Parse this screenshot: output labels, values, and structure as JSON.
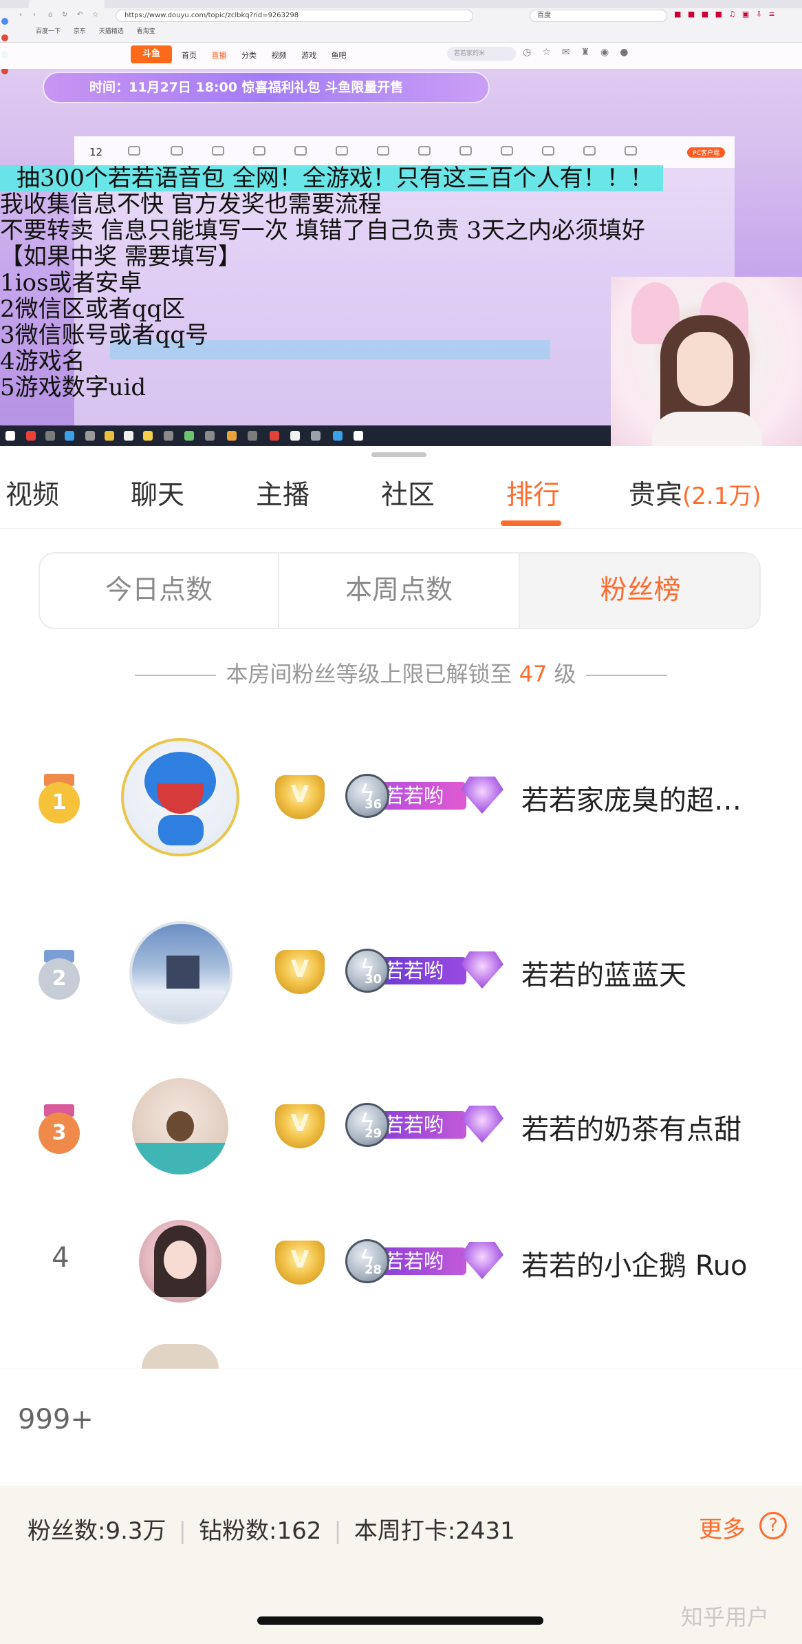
{
  "browser": {
    "url": "https://www.douyu.com/topic/zclbkq?rid=9263298",
    "search_engine": "百度",
    "bookmarks": [
      "百度一下",
      "京东",
      "天猫精选",
      "看淘宝"
    ]
  },
  "site_nav": {
    "logo": "斗鱼",
    "links": [
      "首页",
      "直播",
      "分类",
      "视频",
      "游戏",
      "鱼吧"
    ],
    "search_placeholder": "若若家的米"
  },
  "stream": {
    "banner": "时间：11月27日 18:00  惊喜福利礼包  斗鱼限量开售",
    "toolbar_count": "12",
    "pc_button": "PC客户端",
    "overlay_lines": [
      "抽300个若若语音包 全网！全游戏！只有这三百个人有！！！",
      "我收集信息不快 官方发奖也需要流程",
      "不要转卖 信息只能填写一次 填错了自己负责 3天之内必须填好",
      "【如果中奖 需要填写】",
      "1ios或者安卓",
      "2微信区或者qq区",
      "3微信账号或者qq号",
      "4游戏名",
      "5游戏数字uid"
    ]
  },
  "tabs": [
    {
      "label": "视频"
    },
    {
      "label": "聊天"
    },
    {
      "label": "主播"
    },
    {
      "label": "社区"
    },
    {
      "label": "排行",
      "active": true
    },
    {
      "label": "贵宾",
      "count": "(2.1万)"
    }
  ],
  "segments": [
    {
      "label": "今日点数"
    },
    {
      "label": "本周点数"
    },
    {
      "label": "粉丝榜",
      "active": true
    }
  ],
  "notice": {
    "prefix": "本房间粉丝等级上限已解锁至",
    "level": "47",
    "suffix": "级"
  },
  "ranking": [
    {
      "rank": "1",
      "badge_level": "36",
      "badge_text": "若若哟",
      "name": "若若家庞臭的超…"
    },
    {
      "rank": "2",
      "badge_level": "30",
      "badge_text": "若若哟",
      "name": "若若的蓝蓝天"
    },
    {
      "rank": "3",
      "badge_level": "29",
      "badge_text": "若若哟",
      "name": "若若的奶茶有点甜"
    },
    {
      "rank": "4",
      "badge_level": "28",
      "badge_text": "若若哟",
      "name": "若若的小企鹅 Ruo"
    }
  ],
  "my_rank": "999+",
  "footer": {
    "fans": "粉丝数:9.3万",
    "diamond_fans": "钻粉数:162",
    "weekly_checkin": "本周打卡:2431",
    "more": "更多",
    "help": "?"
  },
  "watermark": "知乎用户",
  "colors": {
    "accent": "#ff6b2c",
    "medal_gold": "#f6c23a",
    "medal_silver": "#c7cdd6",
    "medal_bronze": "#f08a4b",
    "overlay_highlight": "#60e6e6"
  }
}
